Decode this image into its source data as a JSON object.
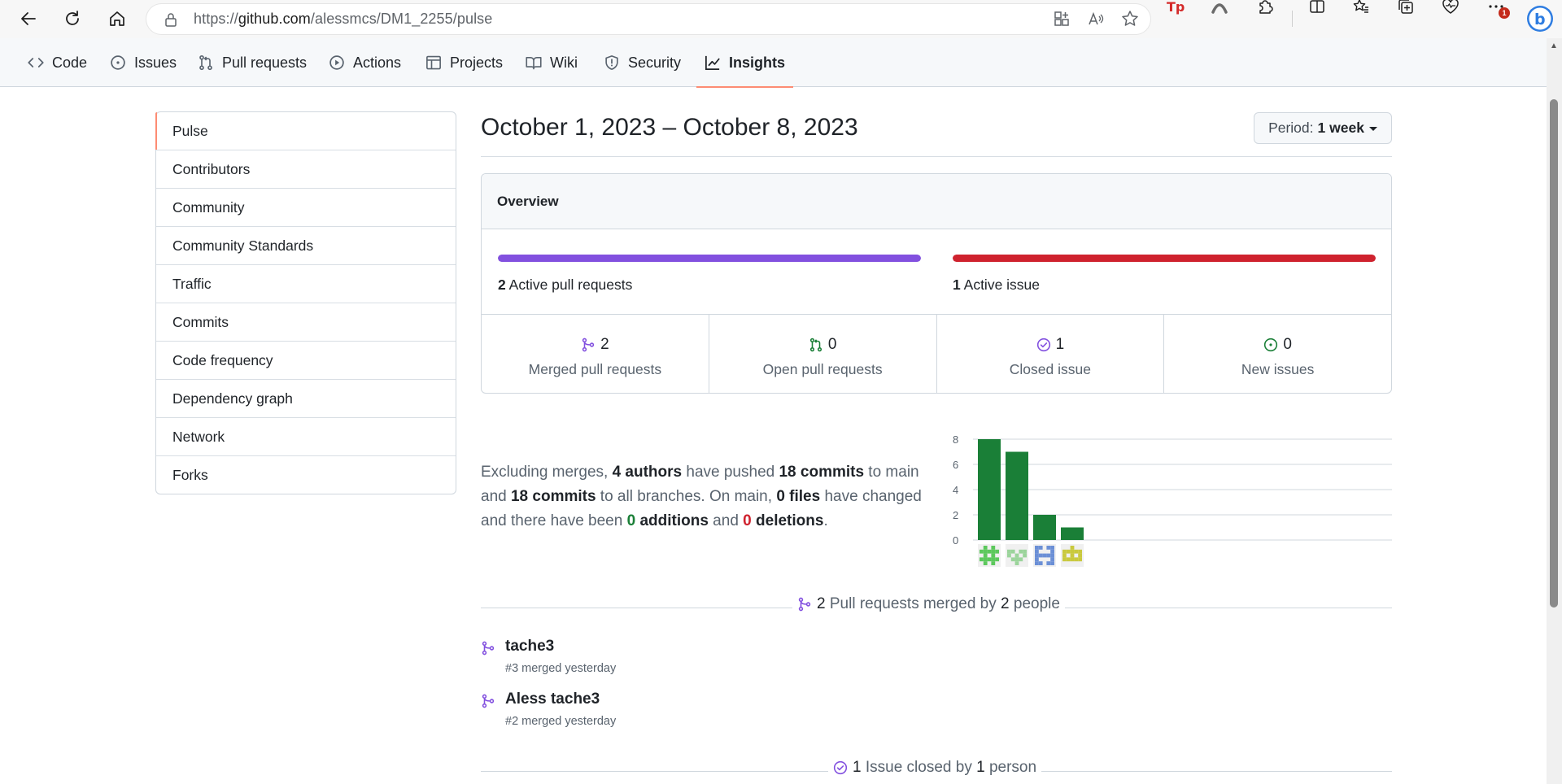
{
  "browser": {
    "url_prefix": "https://",
    "url_host": "github.com",
    "url_path": "/alessmcs/DM1_2255/pulse",
    "notification_count": "1"
  },
  "repo_nav": {
    "tabs": [
      {
        "label": "Code",
        "icon": "code-icon"
      },
      {
        "label": "Issues",
        "icon": "issue-opened-icon"
      },
      {
        "label": "Pull requests",
        "icon": "git-pull-request-icon"
      },
      {
        "label": "Actions",
        "icon": "play-icon"
      },
      {
        "label": "Projects",
        "icon": "table-icon"
      },
      {
        "label": "Wiki",
        "icon": "book-icon"
      },
      {
        "label": "Security",
        "icon": "shield-icon"
      },
      {
        "label": "Insights",
        "icon": "graph-icon",
        "active": true
      }
    ]
  },
  "sidebar": {
    "items": [
      {
        "label": "Pulse",
        "selected": true
      },
      {
        "label": "Contributors"
      },
      {
        "label": "Community"
      },
      {
        "label": "Community Standards"
      },
      {
        "label": "Traffic"
      },
      {
        "label": "Commits"
      },
      {
        "label": "Code frequency"
      },
      {
        "label": "Dependency graph"
      },
      {
        "label": "Network"
      },
      {
        "label": "Forks"
      }
    ]
  },
  "main": {
    "date_range": "October 1, 2023 – October 8, 2023",
    "period_label": "Period:",
    "period_value": "1 week",
    "overview": {
      "title": "Overview",
      "pr_bar": {
        "count": "2",
        "label": "Active pull requests",
        "fill_fraction": 1.0,
        "color": "#8250df"
      },
      "issue_bar": {
        "count": "1",
        "label": "Active issue",
        "fill_fraction": 1.0,
        "color": "#cf222e"
      },
      "stats": [
        {
          "count": "2",
          "label": "Merged pull requests",
          "icon": "git-merge-icon"
        },
        {
          "count": "0",
          "label": "Open pull requests",
          "icon": "git-pull-request-icon"
        },
        {
          "count": "1",
          "label": "Closed issue",
          "icon": "issue-closed-icon"
        },
        {
          "count": "0",
          "label": "New issues",
          "icon": "issue-opened-icon"
        }
      ]
    },
    "summary": {
      "t1": "Excluding merges, ",
      "authors": "4 authors",
      "t2": " have pushed ",
      "commits_main": "18 commits",
      "t3": " to main and ",
      "commits_all": "18 commits",
      "t4": " to all branches. On main, ",
      "files": "0 files",
      "t5": " have changed and there have been ",
      "additions_num": "0",
      "additions_word": " additions",
      "t6": " and ",
      "deletions_num": "0",
      "deletions_word": " deletions",
      "t7": "."
    },
    "merged_section": {
      "count": "2",
      "text1": " Pull requests merged by ",
      "people": "2",
      "text2": " people"
    },
    "pull_requests": [
      {
        "title": "tache3",
        "meta": "#3 merged yesterday"
      },
      {
        "title": "Aless tache3",
        "meta": "#2 merged yesterday"
      }
    ],
    "closed_section": {
      "count": "1",
      "text1": " Issue closed by ",
      "people": "1",
      "text2": " person"
    }
  },
  "chart_data": {
    "type": "bar",
    "categories": [
      "author-1",
      "author-2",
      "author-3",
      "author-4"
    ],
    "values": [
      8,
      7,
      2,
      1
    ],
    "ylim": [
      0,
      8
    ],
    "yticks": [
      "0",
      "2",
      "4",
      "6",
      "8"
    ],
    "bar_color": "#1a7f37",
    "grid": true,
    "avatar_colors": [
      "#5cc85c",
      "#9bd49b",
      "#6b8fd6",
      "#c9c93e"
    ]
  }
}
